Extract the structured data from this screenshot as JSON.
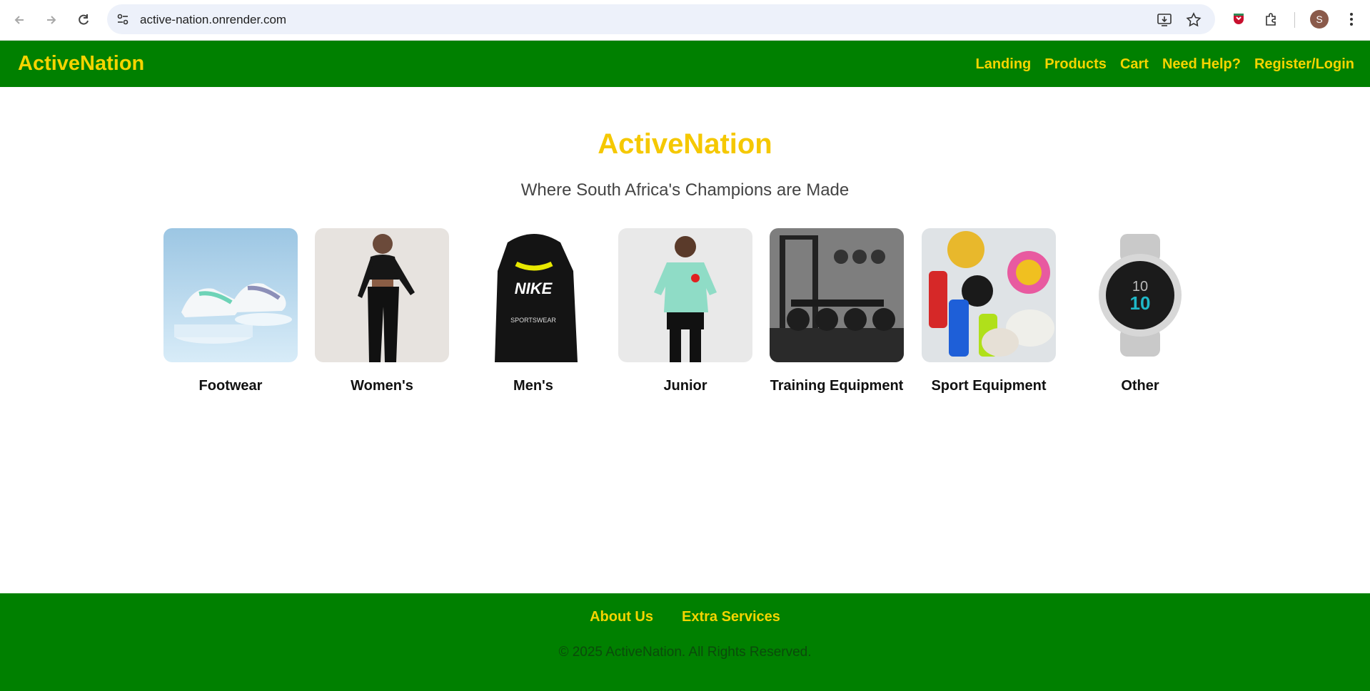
{
  "browser": {
    "url": "active-nation.onrender.com",
    "profile_initial": "S"
  },
  "header": {
    "brand": "ActiveNation",
    "nav": [
      "Landing",
      "Products",
      "Cart",
      "Need Help?",
      "Register/Login"
    ]
  },
  "hero": {
    "title": "ActiveNation",
    "subtitle": "Where South Africa's Champions are Made"
  },
  "categories": [
    {
      "label": "Footwear",
      "image": "sneakers-photo"
    },
    {
      "label": "Women's",
      "image": "womens-activewear-photo"
    },
    {
      "label": "Men's",
      "image": "mens-hoodie-photo"
    },
    {
      "label": "Junior",
      "image": "junior-jersey-photo"
    },
    {
      "label": "Training Equipment",
      "image": "gym-equipment-photo"
    },
    {
      "label": "Sport Equipment",
      "image": "sport-balls-photo"
    },
    {
      "label": "Other",
      "image": "smartwatch-photo"
    }
  ],
  "footer": {
    "links": [
      "About Us",
      "Extra Services"
    ],
    "copyright": "© 2025 ActiveNation. All Rights Reserved."
  },
  "colors": {
    "brand_green": "#008000",
    "brand_yellow": "#f5d400"
  }
}
